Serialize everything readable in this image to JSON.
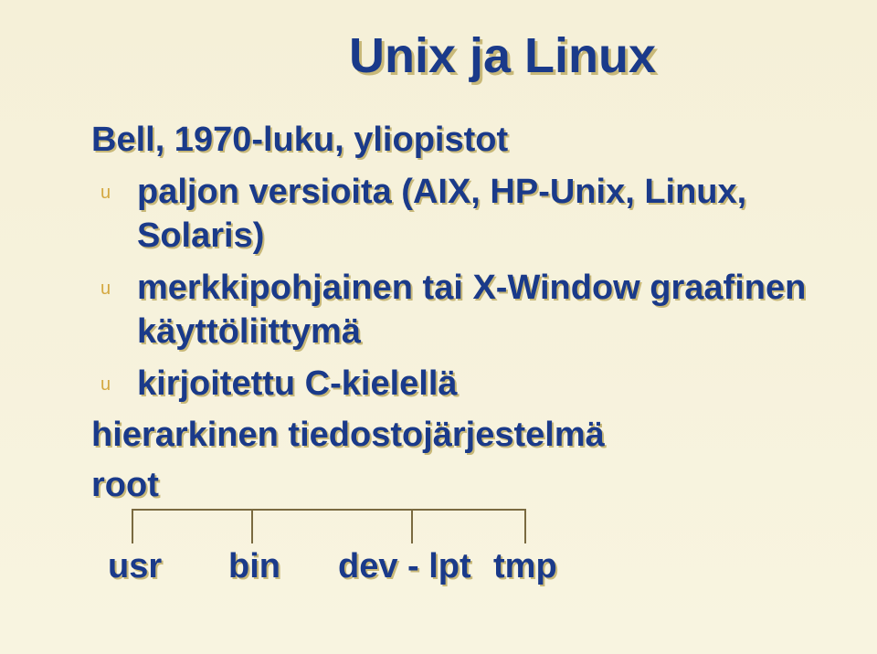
{
  "title": "Unix ja Linux",
  "main": "Bell, 1970-luku, yliopistot",
  "bullets": [
    "paljon versioita (AIX, HP-Unix, Linux, Solaris)",
    "merkkipohjainen tai X-Window graafinen käyttöliittymä",
    "kirjoitettu C-kielellä"
  ],
  "hier_label": "hierarkinen tiedostojärjestelmä",
  "root": "root",
  "tree": {
    "usr": "usr",
    "bin": "bin",
    "devlpt": "dev - lpt",
    "tmp": "tmp"
  }
}
